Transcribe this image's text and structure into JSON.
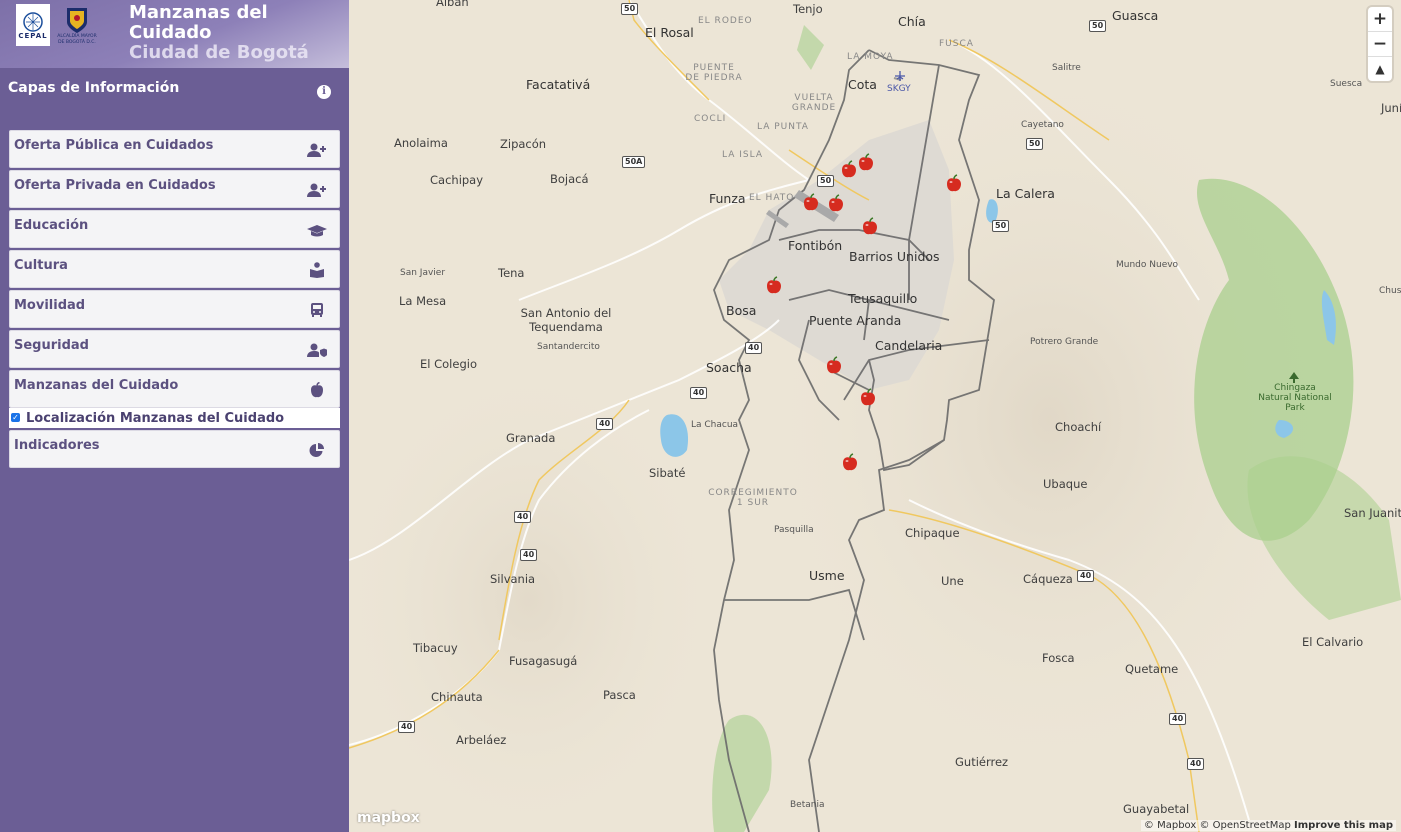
{
  "header": {
    "title_line1": "Manzanas del",
    "title_line2": "Cuidado",
    "title_line3": "Ciudad de Bogotá",
    "logo_cepal_text": "CEPAL",
    "logo_bogota_text": "ALCALDÍA MAYOR DE BOGOTÁ D.C."
  },
  "layers_panel": {
    "title": "Capas de Información",
    "info_icon": "info-icon",
    "items": [
      {
        "label": "Oferta Pública en Cuidados",
        "icon": "user-plus-icon"
      },
      {
        "label": "Oferta Privada en Cuidados",
        "icon": "user-plus-icon"
      },
      {
        "label": "Educación",
        "icon": "graduation-cap-icon"
      },
      {
        "label": "Cultura",
        "icon": "reader-icon"
      },
      {
        "label": "Movilidad",
        "icon": "bus-icon"
      },
      {
        "label": "Seguridad",
        "icon": "user-shield-icon"
      },
      {
        "label": "Manzanas del Cuidado",
        "icon": "apple-icon"
      },
      {
        "label": "Indicadores",
        "icon": "chart-pie-icon"
      }
    ],
    "sublayer": {
      "label": "Localización Manzanas del Cuidado",
      "checked": true
    }
  },
  "map": {
    "places": [
      "Albán",
      "El Rosal",
      "Tenjo",
      "Chía",
      "Guasca",
      "Facatativá",
      "Cota",
      "SKGY",
      "Salitre",
      "Suesca",
      "Anolaima",
      "Zipacón",
      "Cayetano",
      "Cachipay",
      "Bojacá",
      "Funza",
      "La Calera",
      "Fontibón",
      "Barrios Unidos",
      "Tena",
      "San Javier",
      "Mundo Nuevo",
      "La Mesa",
      "Teusaquillo",
      "San Antonio del Tequendama",
      "Bosa",
      "Puente Aranda",
      "Potrero Grande",
      "Santandercito",
      "Candelaria",
      "El Colegio",
      "Soacha",
      "Chingaza Natural National Park",
      "La Chacua",
      "Choachí",
      "Granada",
      "Sibaté",
      "Ubaque",
      "CORREGIMIENTO 1 SUR",
      "Pasquilla",
      "Chipaque",
      "San Juanito",
      "Silvania",
      "Usme",
      "Une",
      "Cáqueza",
      "El Calvario",
      "Tibacuy",
      "Fusagasugá",
      "Fosca",
      "Quetame",
      "Chinauta",
      "Pasca",
      "Arbeláez",
      "Gutiérrez",
      "Betania",
      "Guayabetal",
      "EL RODEO",
      "LA MOYA",
      "FUSCA",
      "PUENTE DE PIEDRA",
      "VUELTA GRANDE",
      "COCLI",
      "LA PUNTA",
      "LA ISLA",
      "EL HATO",
      "Juní",
      "Chus"
    ],
    "road_shields": [
      "50",
      "50",
      "50A",
      "50",
      "50",
      "50",
      "40",
      "40",
      "40",
      "40",
      "40",
      "40",
      "40",
      "40",
      "40"
    ],
    "markers_count": 11,
    "marker_icon": "apple-marker-icon",
    "zoom_in": "+",
    "zoom_out": "−",
    "compass": "▲",
    "logo": "mapbox",
    "attribution": "© Mapbox © OpenStreetMap",
    "improve": "Improve this map"
  },
  "colors": {
    "sidebar": "#6b5e95",
    "panel_item": "#f4f4f6",
    "label": "#5c5180",
    "map_base": "#ece5d6",
    "park_green": "#a9cf8d",
    "water": "#8cc6e8",
    "border": "#6a6a6a"
  }
}
